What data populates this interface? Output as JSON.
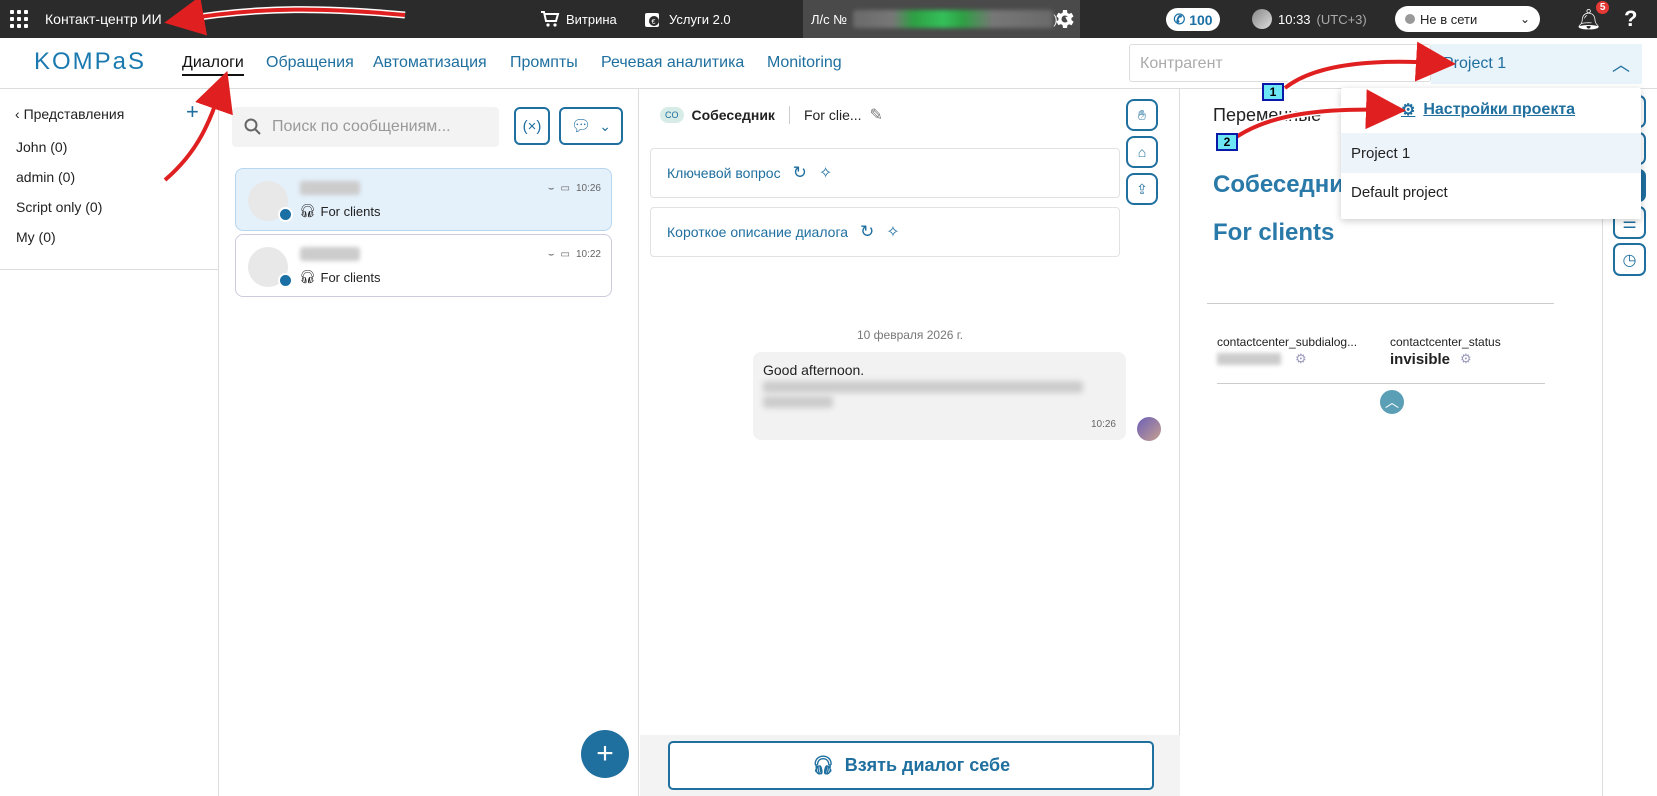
{
  "topbar": {
    "app_title": "Контакт-центр ИИ",
    "showcase": "Витрина",
    "services": "Услуги 2.0",
    "account_prefix": "Л/с №",
    "account_suffix": ")",
    "phone_count": "100",
    "time": "10:33",
    "timezone": "(UTC+3)",
    "status": "Не в сети",
    "notifications": "5",
    "help": "?"
  },
  "nav": {
    "logo": "KOMPaS",
    "items": [
      "Диалоги",
      "Обращения",
      "Автоматизация",
      "Промпты",
      "Речевая аналитика",
      "Monitoring"
    ],
    "active": "Диалоги",
    "counterparty_placeholder": "Контрагент",
    "project": "Project 1"
  },
  "views": {
    "title": "Представления",
    "items": [
      "John (0)",
      "admin (0)",
      "Script only (0)",
      "My (0)"
    ]
  },
  "dialogs": {
    "search_placeholder": "Поиск по сообщениям...",
    "items": [
      {
        "queue": "For clients",
        "time": "10:26"
      },
      {
        "queue": "For clients",
        "time": "10:22"
      }
    ]
  },
  "chat": {
    "badge": "CO",
    "interlocutor": "Собеседник",
    "channel": "For clie...",
    "key_question": "Ключевой вопрос",
    "short_description": "Короткое описание диалога",
    "date": "10 февраля 2026 г.",
    "message_text": "Good afternoon.",
    "message_time": "10:26",
    "take_button": "Взять диалог себе"
  },
  "right_panel": {
    "variables_title": "Переменные",
    "interlocutor": "Собеседник",
    "queue": "For clients",
    "vars": [
      {
        "name": "contactcenter_subdialog...",
        "value": ""
      },
      {
        "name": "contactcenter_status",
        "value": "invisible"
      }
    ]
  },
  "project_dropdown": {
    "settings": "Настройки проекта",
    "options": [
      "Project 1",
      "Default project"
    ]
  },
  "annotations": {
    "marker1": "1",
    "marker2": "2"
  },
  "colors": {
    "accent": "#1f6f9f",
    "topbar": "#2b2b2b",
    "arrow": "#e02020"
  }
}
